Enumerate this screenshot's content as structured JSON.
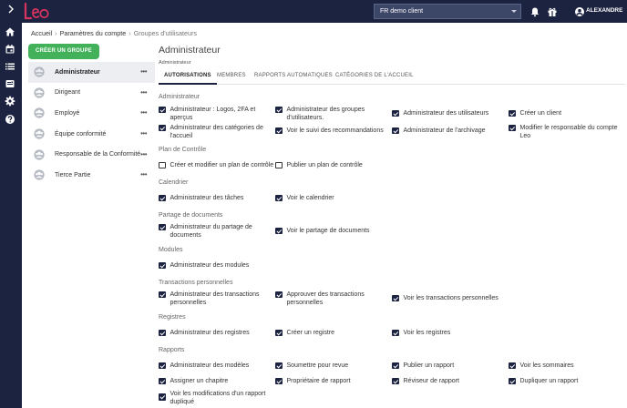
{
  "brand": {
    "logo_text": "Leo",
    "logo_color": "#d6335f",
    "topbar_color": "#1c2340"
  },
  "header": {
    "client_selector": {
      "value": "FR demo client"
    },
    "user": {
      "name": "ALEXANDRE"
    },
    "icons": [
      "bell-icon",
      "gift-icon",
      "account-icon"
    ]
  },
  "rail": {
    "icons": [
      "home-icon",
      "calendar-icon",
      "list-icon",
      "document-icon",
      "gear-icon",
      "help-icon"
    ]
  },
  "breadcrumb": {
    "items": [
      "Accueil",
      "Paramètres du compte",
      "Groupes d'utilisateurs"
    ]
  },
  "groups": {
    "create_label": "CRÉER UN GROUPE",
    "create_color": "#43b15a",
    "items": [
      {
        "label": "Administrateur",
        "active": true
      },
      {
        "label": "Dirigeant"
      },
      {
        "label": "Employé"
      },
      {
        "label": "Équipe conformité"
      },
      {
        "label": "Responsable de la Conformité"
      },
      {
        "label": "Tierce Partie"
      }
    ],
    "menu_label": "•••"
  },
  "main": {
    "title": "Administrateur",
    "subtitle": "Administrateur",
    "tabs": [
      {
        "label": "AUTORISATIONS",
        "active": true
      },
      {
        "label": "MEMBRES"
      },
      {
        "label": "RAPPORTS AUTOMATIQUES"
      },
      {
        "label": "CATÉGORIES DE L'ACCUEIL"
      }
    ]
  },
  "sections": [
    {
      "title": "Administrateur"
    },
    {
      "title": "Plan de Contrôle"
    },
    {
      "title": "Calendrier"
    },
    {
      "title": "Partage de documents"
    },
    {
      "title": "Modules"
    },
    {
      "title": "Transactions personnelles"
    },
    {
      "title": "Registres"
    },
    {
      "title": "Rapports"
    }
  ],
  "permissions": [
    {
      "label": "Administrateur : Logos, 2FA et aperçus",
      "checked": true
    },
    {
      "label": "Administrateur des groupes d'utilisateurs.",
      "checked": true
    },
    {
      "label": "Administrateur des utilisateurs",
      "checked": true
    },
    {
      "label": "Créer un client",
      "checked": true
    },
    {
      "label": "Administrateur des catégories de l'accueil",
      "checked": true
    },
    {
      "label": "Voir le suivi des recommandations",
      "checked": true
    },
    {
      "label": "Administrateur de l'archivage",
      "checked": true
    },
    {
      "label": "Modifier le responsable du compte Leo",
      "checked": true
    },
    {
      "label": "Créer et modifier un plan de contrôle",
      "checked": false
    },
    {
      "label": "Publier un plan de contrôle",
      "checked": false
    },
    {
      "label": "Administrateur des tâches",
      "checked": true
    },
    {
      "label": "Voir le calendrier",
      "checked": true
    },
    {
      "label": "Administrateur du partage de documents",
      "checked": true
    },
    {
      "label": "Voir le partage de documents",
      "checked": true
    },
    {
      "label": "Administrateur des modules",
      "checked": true
    },
    {
      "label": "Administrateur des transactions personnelles",
      "checked": true
    },
    {
      "label": "Approuver des transactions personnelles",
      "checked": true
    },
    {
      "label": "Voir les transactions personnelles",
      "checked": true
    },
    {
      "label": "Administrateur des registres",
      "checked": true
    },
    {
      "label": "Créer un registre",
      "checked": true
    },
    {
      "label": "Voir les registres",
      "checked": true
    },
    {
      "label": "Administrateur des modèles",
      "checked": true
    },
    {
      "label": "Soumettre pour revue",
      "checked": true
    },
    {
      "label": "Publier un rapport",
      "checked": true
    },
    {
      "label": "Voir les sommaires",
      "checked": true
    },
    {
      "label": "Assigner un chapitre",
      "checked": true
    },
    {
      "label": "Propriétaire de rapport",
      "checked": true
    },
    {
      "label": "Réviseur de rapport",
      "checked": true
    },
    {
      "label": "Dupliquer un rapport",
      "checked": true
    },
    {
      "label": "Voir les modifications d'un rapport dupliqué",
      "checked": true
    }
  ]
}
